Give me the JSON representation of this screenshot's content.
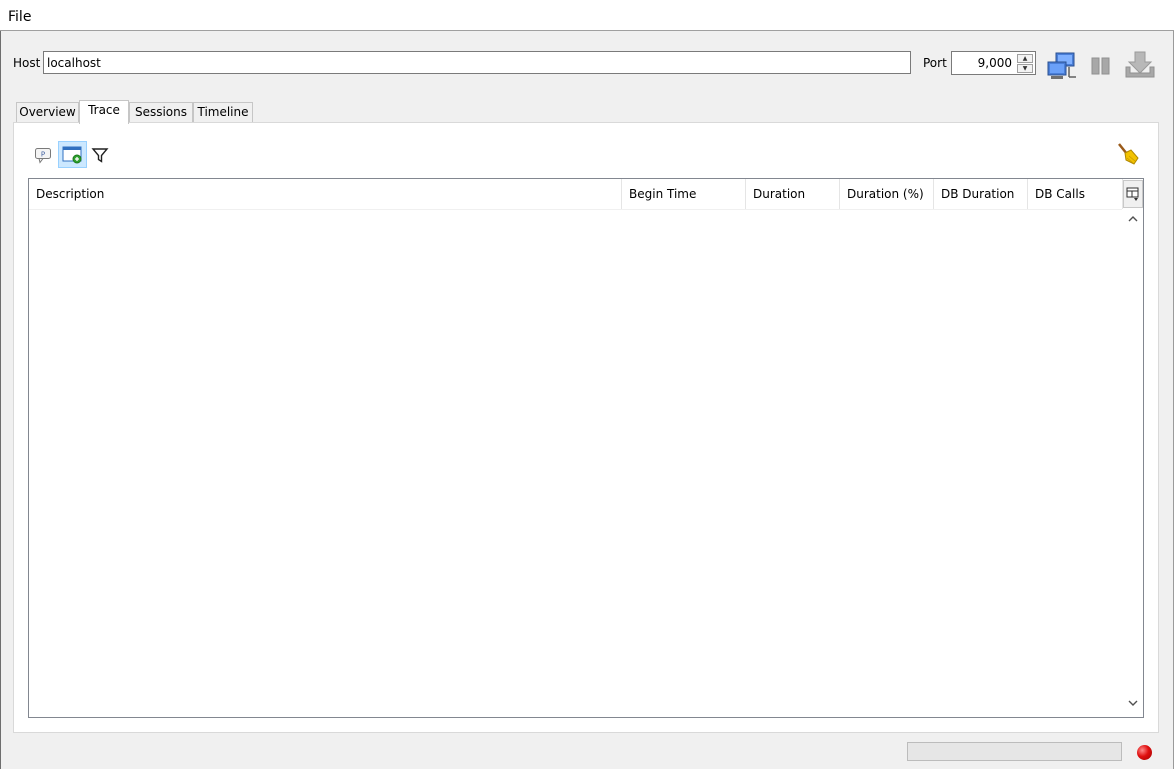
{
  "menu": {
    "file_label": "File"
  },
  "connection": {
    "host_label": "Host",
    "host_value": "localhost",
    "port_label": "Port",
    "port_value": "9,000"
  },
  "toolbar": {
    "connect_icon": "monitors-network-icon",
    "pause_icon": "pause-icon",
    "download_icon": "download-icon"
  },
  "tabs": [
    {
      "label": "Overview",
      "active": false
    },
    {
      "label": "Trace",
      "active": true
    },
    {
      "label": "Sessions",
      "active": false
    },
    {
      "label": "Timeline",
      "active": false
    }
  ],
  "trace_toolbar": {
    "icons": [
      "comment-icon",
      "window-add-icon",
      "filter-icon"
    ],
    "clear_icon": "broom-icon"
  },
  "table": {
    "columns": [
      "Description",
      "Begin Time",
      "Duration",
      "Duration (%)",
      "DB Duration",
      "DB Calls"
    ],
    "rows": []
  },
  "status": {
    "progress": 0,
    "light_color": "#e01010"
  },
  "colors": {
    "accent_selected": "#cce8ff",
    "accent_border": "#99d1ff"
  }
}
